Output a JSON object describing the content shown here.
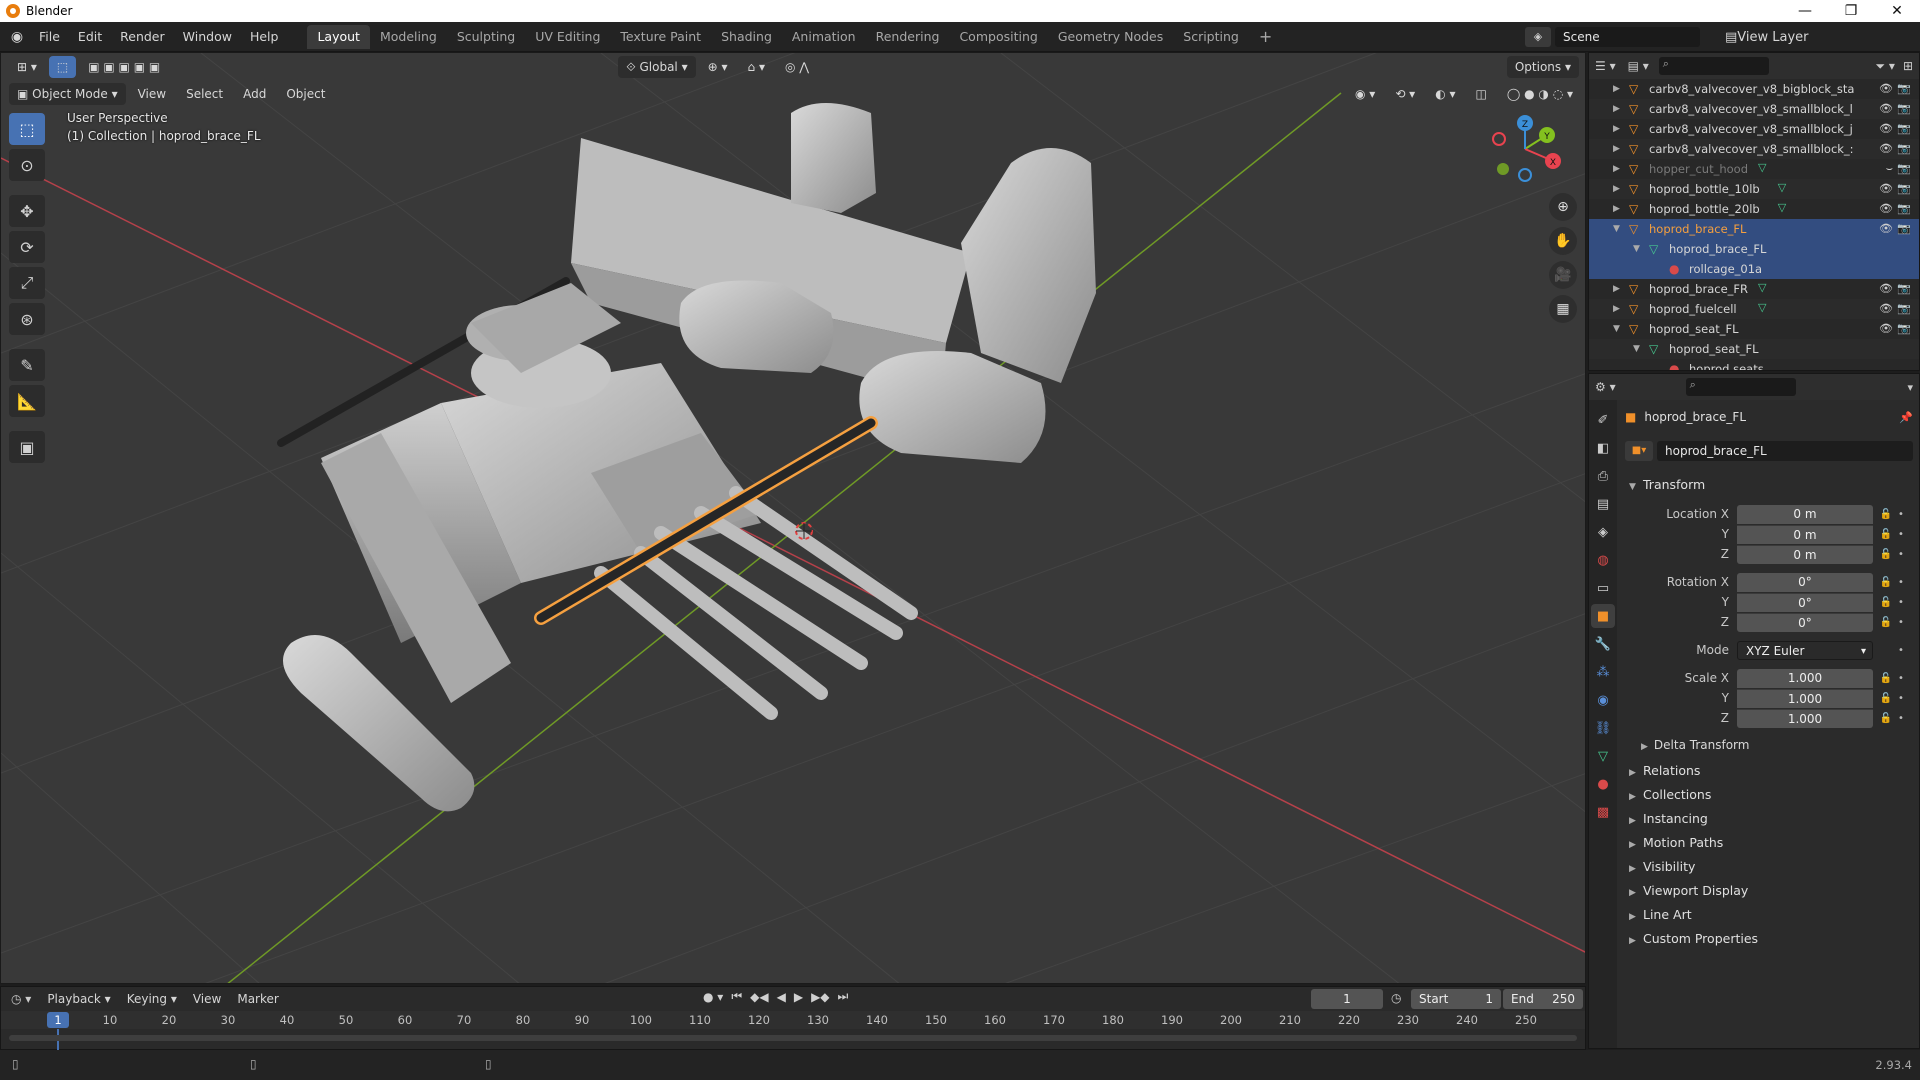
{
  "window": {
    "title": "Blender",
    "controls": [
      "—",
      "❐",
      "✕"
    ]
  },
  "menu": [
    "File",
    "Edit",
    "Render",
    "Window",
    "Help"
  ],
  "workspaces": {
    "tabs": [
      "Layout",
      "Modeling",
      "Sculpting",
      "UV Editing",
      "Texture Paint",
      "Shading",
      "Animation",
      "Rendering",
      "Compositing",
      "Geometry Nodes",
      "Scripting"
    ],
    "active": "Layout",
    "add": "+"
  },
  "scene": {
    "name": "Scene",
    "view_layer": "View Layer"
  },
  "viewport": {
    "mode": "Object Mode",
    "menus": [
      "View",
      "Select",
      "Add",
      "Object"
    ],
    "orientation": "Global",
    "options_label": "Options",
    "perspective": "User Perspective",
    "collection_info": "(1) Collection | hoprod_brace_FL",
    "gizmo_axes": {
      "x": "X",
      "y": "Y",
      "z": "Z"
    }
  },
  "outliner": {
    "rows": [
      {
        "name": "carbv8_valvecover_v8_bigblock_sta",
        "indent": 0,
        "type": "object",
        "expanded": false,
        "visible": true
      },
      {
        "name": "carbv8_valvecover_v8_smallblock_l",
        "indent": 0,
        "type": "object",
        "expanded": false,
        "visible": true
      },
      {
        "name": "carbv8_valvecover_v8_smallblock_j",
        "indent": 0,
        "type": "object",
        "expanded": false,
        "visible": true
      },
      {
        "name": "carbv8_valvecover_v8_smallblock_:",
        "indent": 0,
        "type": "object",
        "expanded": false,
        "visible": true
      },
      {
        "name": "hopper_cut_hood",
        "indent": 0,
        "type": "object",
        "expanded": false,
        "visible": false,
        "dim": true,
        "mesh": true
      },
      {
        "name": "hoprod_bottle_10lb",
        "indent": 0,
        "type": "object",
        "expanded": false,
        "visible": true,
        "mesh": true
      },
      {
        "name": "hoprod_bottle_20lb",
        "indent": 0,
        "type": "object",
        "expanded": false,
        "visible": true,
        "mesh": true
      },
      {
        "name": "hoprod_brace_FL",
        "indent": 0,
        "type": "object",
        "expanded": true,
        "visible": true,
        "selected": true,
        "active": true
      },
      {
        "name": "hoprod_brace_FL",
        "indent": 1,
        "type": "mesh",
        "expanded": true,
        "selected": true
      },
      {
        "name": "rollcage_01a",
        "indent": 2,
        "type": "material",
        "selected": true
      },
      {
        "name": "hoprod_brace_FR",
        "indent": 0,
        "type": "object",
        "expanded": false,
        "visible": true,
        "mesh": true
      },
      {
        "name": "hoprod_fuelcell",
        "indent": 0,
        "type": "object",
        "expanded": false,
        "visible": true,
        "mesh": true
      },
      {
        "name": "hoprod_seat_FL",
        "indent": 0,
        "type": "object",
        "expanded": true,
        "visible": true
      },
      {
        "name": "hoprod_seat_FL",
        "indent": 1,
        "type": "mesh",
        "expanded": true
      },
      {
        "name": "hoprod seats",
        "indent": 2,
        "type": "material"
      }
    ]
  },
  "properties": {
    "object_name": "hoprod_brace_FL",
    "name_field": "hoprod_brace_FL",
    "transform": {
      "title": "Transform",
      "location_label": "Location X",
      "location": [
        "0 m",
        "0 m",
        "0 m"
      ],
      "rotation_label": "Rotation X",
      "rotation": [
        "0°",
        "0°",
        "0°"
      ],
      "mode_label": "Mode",
      "mode": "XYZ Euler",
      "scale_label": "Scale X",
      "scale": [
        "1.000",
        "1.000",
        "1.000"
      ],
      "y_label": "Y",
      "z_label": "Z",
      "delta": "Delta Transform"
    },
    "panels": [
      "Relations",
      "Collections",
      "Instancing",
      "Motion Paths",
      "Visibility",
      "Viewport Display",
      "Line Art",
      "Custom Properties"
    ]
  },
  "timeline": {
    "menus": [
      "Playback",
      "Keying",
      "View",
      "Marker"
    ],
    "current_frame": "1",
    "start_label": "Start",
    "start": "1",
    "end_label": "End",
    "end": "250",
    "ruler": [
      "10",
      "20",
      "30",
      "40",
      "50",
      "60",
      "70",
      "80",
      "90",
      "100",
      "110",
      "120",
      "130",
      "140",
      "150",
      "160",
      "170",
      "180",
      "190",
      "200",
      "210",
      "220",
      "230",
      "240",
      "250"
    ],
    "cursor_label": "1"
  },
  "status": {
    "version": "2.93.4"
  },
  "colors": {
    "accent": "#4772b3",
    "selection_orange": "#f5a040",
    "x_axis": "#e8434f",
    "y_axis": "#84c01f",
    "z_axis": "#3b8fd8"
  }
}
